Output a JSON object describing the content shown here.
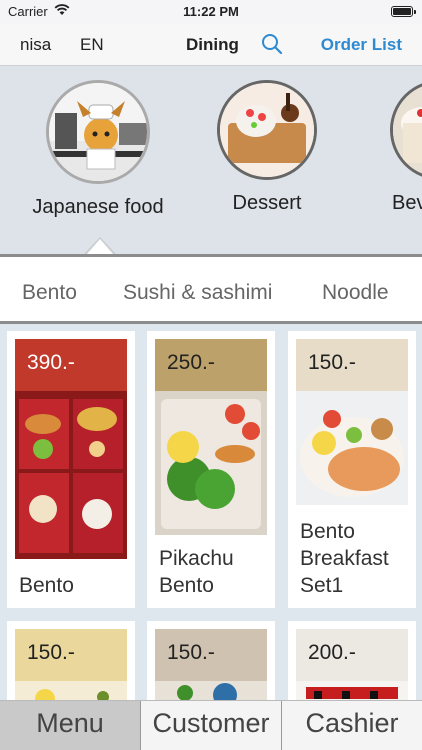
{
  "status_bar": {
    "carrier": "Carrier",
    "time": "11:22 PM"
  },
  "nav": {
    "lang_user": "nisa",
    "lang_code": "EN",
    "title": "Dining",
    "order_list": "Order List"
  },
  "categories": [
    {
      "label": "Japanese food"
    },
    {
      "label": "Dessert"
    },
    {
      "label": "Bev"
    }
  ],
  "subcategories": [
    {
      "label": "Bento"
    },
    {
      "label": "Sushi & sashimi"
    },
    {
      "label": "Noodle"
    }
  ],
  "menu_items": [
    {
      "price": "390.-",
      "name_line1": "Bento",
      "name_line2": "",
      "name_line3": "",
      "price_color": "#c0392b",
      "price_text_color": "#ffffff"
    },
    {
      "price": "250.-",
      "name_line1": "Pikachu",
      "name_line2": "Bento",
      "name_line3": "",
      "price_color": "#bca16b",
      "price_text_color": "#222222"
    },
    {
      "price": "150.-",
      "name_line1": "Bento",
      "name_line2": "Breakfast",
      "name_line3": "Set1",
      "price_color": "#e6dcc8",
      "price_text_color": "#222222"
    },
    {
      "price": "150.-",
      "price_color": "#ead79b",
      "price_text_color": "#222222"
    },
    {
      "price": "150.-",
      "price_color": "#cfc2b0",
      "price_text_color": "#222222"
    },
    {
      "price": "200.-",
      "price_color": "#ece8e2",
      "price_text_color": "#222222"
    }
  ],
  "tabbar": {
    "menu": "Menu",
    "customer": "Customer",
    "cashier": "Cashier"
  },
  "icons": {
    "wifi": "wifi-icon",
    "battery": "battery-icon",
    "search": "search-icon"
  },
  "colors": {
    "accent": "#2e8ad1",
    "category_bg": "#dde3e8",
    "grid_bg": "#dfe7ee"
  }
}
